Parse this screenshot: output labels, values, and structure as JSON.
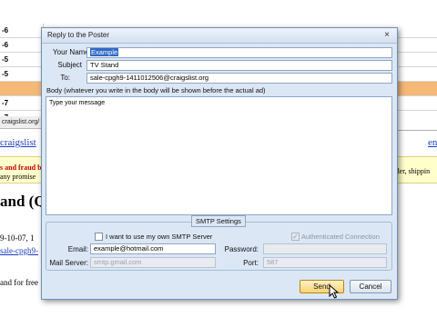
{
  "background": {
    "left_rows": [
      "-6",
      "-6",
      "-5",
      "-5",
      "",
      "-7",
      "-7"
    ],
    "right_rows": [
      "",
      "",
      "",
      "",
      "",
      "",
      ""
    ],
    "url_fragment": "craigslist.org/",
    "cl_link": "craigslist",
    "en_link": "en",
    "warning_line1": "s and fraud b",
    "warning_line2": "any promise",
    "warning_right": "rder, shippin",
    "heading": "and (Q",
    "date_text": "9-10-07, 1",
    "email_link": "sale-cpgh9-",
    "body_text": "and for free"
  },
  "dialog": {
    "title": "Reply to the Poster",
    "close_glyph": "×",
    "your_name_label": "Your Name:",
    "your_name_value": "Example",
    "subject_label": "Subject",
    "subject_value": "TV Stand",
    "to_label": "To:",
    "to_value": "sale-cpgh9-1411012506@craigslist.org",
    "body_label": "Body (whatever you write in the body will be shown before the actual ad)",
    "body_text": "Type your message",
    "smtp": {
      "title": "SMTP Settings",
      "own_server_label": "I want to use my own SMTP Server",
      "own_server_checked": false,
      "auth_label": "Authenticated Connection",
      "auth_checked": true,
      "email_label": "Email:",
      "email_value": "example@hotmail.com",
      "password_label": "Password:",
      "password_value": "",
      "mail_server_label": "Mail Server:",
      "mail_server_value": "smtp.gmail.com",
      "port_label": "Port:",
      "port_value": "587"
    },
    "send_label": "Send",
    "cancel_label": "Cancel"
  },
  "colors": {
    "dialog_bg": "#dce7f5",
    "highlight_row": "#f4b877",
    "link": "#1b3dc2",
    "warning_red": "#c00000",
    "selection": "#3169c6",
    "default_button": "#fbd471"
  }
}
